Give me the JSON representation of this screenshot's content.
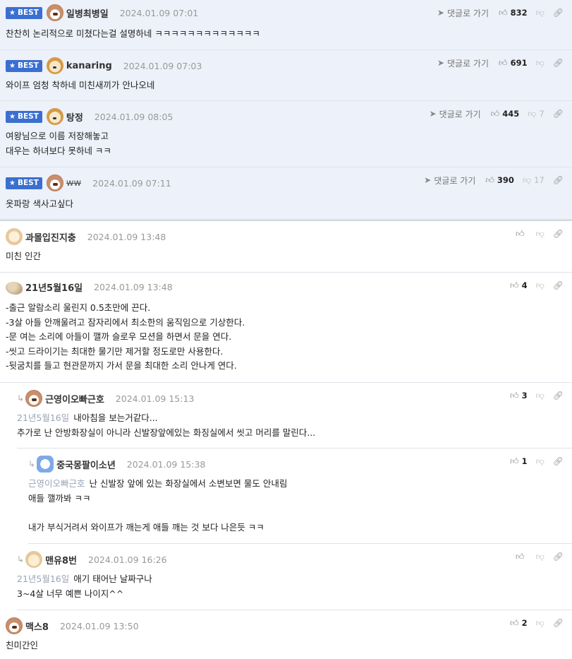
{
  "best_label": "BEST",
  "goto_label": "댓글로 가기",
  "best_comments": [
    {
      "nick": "일병최병일",
      "date": "2024.01.09 07:01",
      "likes": "832",
      "dislikes": "",
      "text": "찬찬히 논리적으로 미쳤다는걸 설명하네 ㅋㅋㅋㅋㅋㅋㅋㅋㅋㅋㅋㅋㅋ"
    },
    {
      "nick": "kanaring",
      "date": "2024.01.09 07:03",
      "likes": "691",
      "dislikes": "",
      "text": "와이프 엄청 착하네 미친새끼가 안나오네"
    },
    {
      "nick": "탕정",
      "date": "2024.01.09 08:05",
      "likes": "445",
      "dislikes": "7",
      "text": "여왕님으로 이름 저장해놓고\n대우는 하녀보다 못하네 ㅋㅋ"
    },
    {
      "nick": "ww",
      "date": "2024.01.09 07:11",
      "likes": "390",
      "dislikes": "17",
      "text": "옷파랑 색사고싶다"
    }
  ],
  "comments": [
    {
      "nick": "과몰입진지충",
      "date": "2024.01.09 13:48",
      "likes": "",
      "text": "미친 인간"
    },
    {
      "nick": "21년5월16일",
      "date": "2024.01.09 13:48",
      "likes": "4",
      "text": "-출근 알람소리 울린지 0.5초만에 끈다.\n-3살 아들 안깨울려고 잠자리에서 최소한의 움직임으로 기상한다.\n-문 여는 소리에 아들이 깰까 슬로우 모션을 하면서 문을 연다.\n-씻고 드라이기는 최대한 물기만 제거할 정도로만 사용한다.\n-뒷굼치를 들고 현관문까지 가서 문을 최대한 소리 안나게 연다."
    },
    {
      "nick": "근영이오빠근호",
      "date": "2024.01.09 15:13",
      "likes": "3",
      "mention": "21년5월16일",
      "text": "내아침을 보는거같다...",
      "text2": "추가로 난 안방화장실이 아니라 신발장앞에있는 화징실에서 씻고 머리를 말린다..."
    },
    {
      "nick": "중국몽팔이소년",
      "date": "2024.01.09 15:38",
      "likes": "1",
      "mention": "근영이오빠근호",
      "text": "난 신발장 앞에 있는 화장실에서 소변보면 물도 안내림",
      "text2": "애들 깰까봐 ㅋㅋ\n\n내가 부식거려서 와이프가 깨는게 애들 깨는 것 보다 나은듯 ㅋㅋ"
    },
    {
      "nick": "맨유8번",
      "date": "2024.01.09 16:26",
      "likes": "",
      "mention": "21년5월16일",
      "text": "애기 태어난 날짜구나",
      "text2": "3~4살 너무 예쁜 나이지^^"
    },
    {
      "nick": "맥스8",
      "date": "2024.01.09 13:50",
      "likes": "2",
      "text": "친미간인"
    }
  ]
}
